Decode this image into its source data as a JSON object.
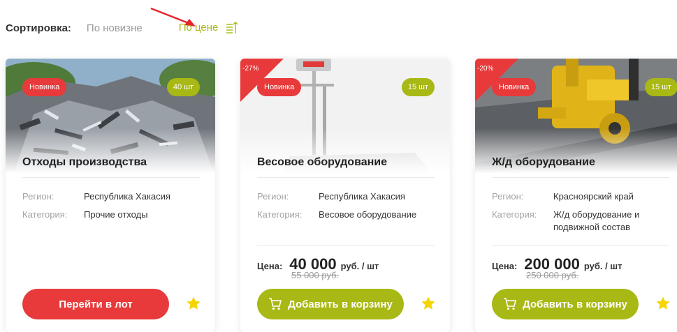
{
  "sort": {
    "label": "Сортировка:",
    "option_new": "По новизне",
    "option_price": "По цене"
  },
  "colors": {
    "accent_green": "#a8b814",
    "accent_red": "#e83a3a"
  },
  "cards": [
    {
      "badge_new": "Новинка",
      "qty": "40 шт",
      "title": "Отходы производства",
      "region_key": "Регион:",
      "region_val": "Республика Хакасия",
      "category_key": "Категория:",
      "category_val": "Прочие отходы",
      "button": "Перейти в лот"
    },
    {
      "discount": "-27%",
      "badge_new": "Новинка",
      "qty": "15 шт",
      "title": "Весовое оборудование",
      "region_key": "Регион:",
      "region_val": "Республика Хакасия",
      "category_key": "Категория:",
      "category_val": "Весовое оборудование",
      "price_label": "Цена:",
      "price": "40 000",
      "price_unit": "руб. / шт",
      "old_price": "55 000 руб.",
      "button": "Добавить в корзину"
    },
    {
      "discount": "-20%",
      "badge_new": "Новинка",
      "qty": "15 шт",
      "title": "Ж/д оборудование",
      "region_key": "Регион:",
      "region_val": "Красноярский край",
      "category_key": "Категория:",
      "category_val_line1": "Ж/д оборудование и",
      "category_val_line2": "подвижной состав",
      "price_label": "Цена:",
      "price": "200 000",
      "price_unit": "руб. / шт",
      "old_price": "250 000 руб.",
      "button": "Добавить в корзину"
    }
  ]
}
